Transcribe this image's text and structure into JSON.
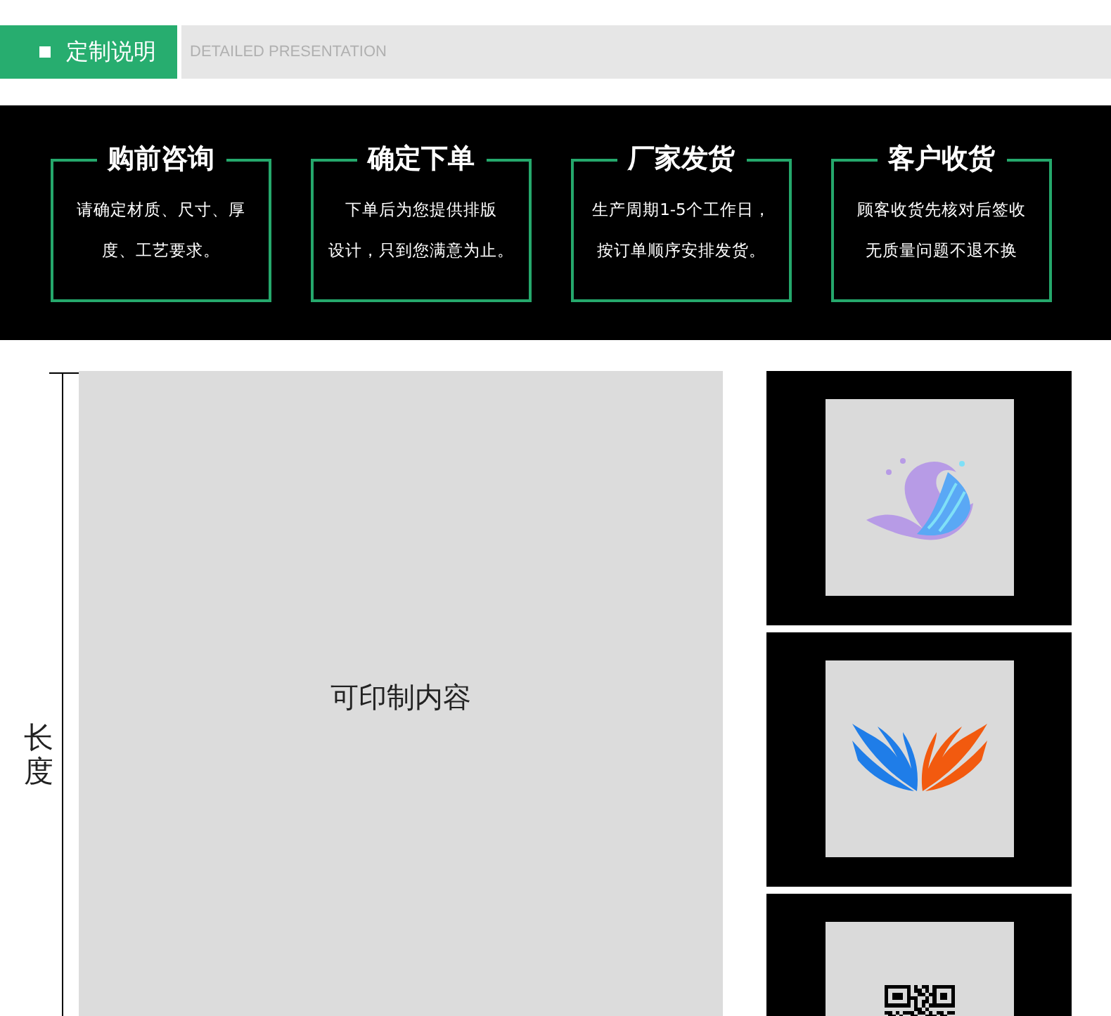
{
  "header": {
    "title": "定制说明",
    "subtitle": "DETAILED PRESENTATION"
  },
  "steps": [
    {
      "title": "购前咨询",
      "lines": [
        "请确定材质、尺寸、厚",
        "度、工艺要求。"
      ]
    },
    {
      "title": "确定下单",
      "lines": [
        "下单后为您提供排版",
        "设计，只到您满意为止。"
      ]
    },
    {
      "title": "厂家发货",
      "lines": [
        "生产周期1-5个工作日，",
        "按订单顺序安排发货。"
      ]
    },
    {
      "title": "客户收货",
      "lines": [
        "顾客收货先核对后签收",
        "无质量问题不退不换"
      ]
    }
  ],
  "print_area": {
    "dimension_label": "长度",
    "content_label": "可印制内容"
  },
  "samples": [
    {
      "kind": "wave"
    },
    {
      "kind": "wings"
    },
    {
      "kind": "qr"
    }
  ]
}
